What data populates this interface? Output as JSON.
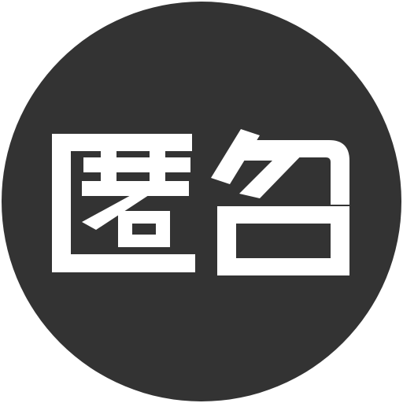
{
  "icon": {
    "name": "anonymous-badge-icon",
    "text": "匿名",
    "colors": {
      "circle": "#333333",
      "glyph": "#ffffff",
      "background": "#ffffff"
    }
  }
}
